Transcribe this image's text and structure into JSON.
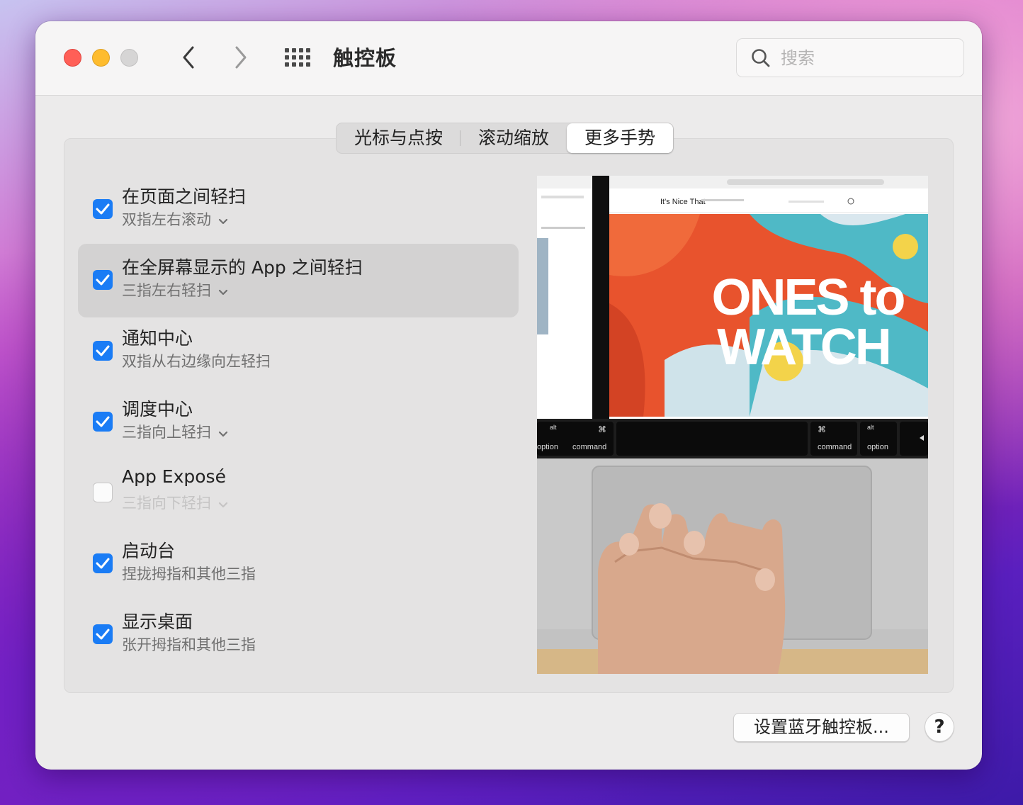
{
  "window": {
    "title": "触控板"
  },
  "search": {
    "placeholder": "搜索"
  },
  "tabs": [
    {
      "label": "光标与点按"
    },
    {
      "label": "滚动缩放"
    },
    {
      "label": "更多手势",
      "active": true
    }
  ],
  "gestures": [
    {
      "title": "在页面之间轻扫",
      "subtitle": "双指左右滚动",
      "checked": true,
      "has_menu": true
    },
    {
      "title": "在全屏幕显示的 App 之间轻扫",
      "subtitle": "三指左右轻扫",
      "checked": true,
      "has_menu": true,
      "selected": true
    },
    {
      "title": "通知中心",
      "subtitle": "双指从右边缘向左轻扫",
      "checked": true,
      "has_menu": false
    },
    {
      "title": "调度中心",
      "subtitle": "三指向上轻扫",
      "checked": true,
      "has_menu": true
    },
    {
      "title": "App Exposé",
      "subtitle": "三指向下轻扫",
      "checked": false,
      "has_menu": true
    },
    {
      "title": "启动台",
      "subtitle": "捏拢拇指和其他三指",
      "checked": true,
      "has_menu": false
    },
    {
      "title": "显示桌面",
      "subtitle": "张开拇指和其他三指",
      "checked": true,
      "has_menu": false
    }
  ],
  "preview": {
    "headline_line1": "ONES to",
    "headline_line2": "WATCH",
    "site_name": "It's Nice That",
    "keys": {
      "alt": "alt",
      "option": "option",
      "command": "command",
      "cmd_symbol": "⌘"
    }
  },
  "footer": {
    "bluetooth_button": "设置蓝牙触控板...",
    "help_label": "?"
  },
  "colors": {
    "accent": "#1a7cf5",
    "close": "#ff5f57",
    "minimize": "#febc2e"
  }
}
